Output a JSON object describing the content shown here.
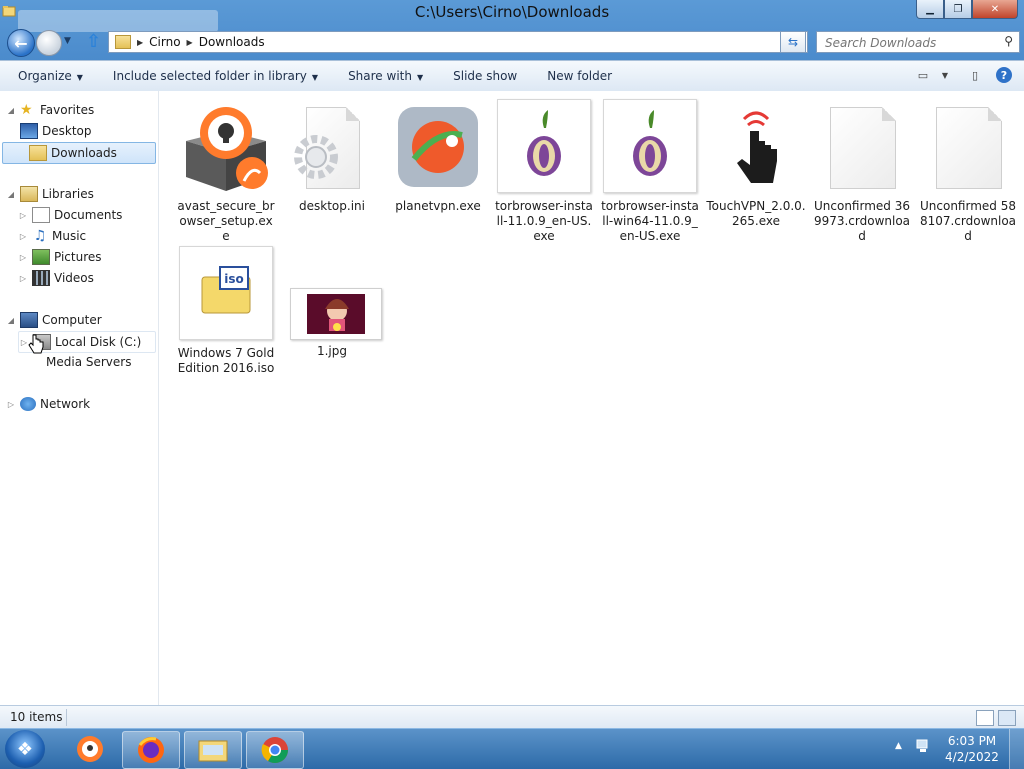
{
  "window": {
    "title": "C:\\Users\\Cirno\\Downloads"
  },
  "address": {
    "crumbs": [
      "Cirno",
      "Downloads"
    ]
  },
  "search": {
    "placeholder": "Search Downloads"
  },
  "toolbar": {
    "organize": "Organize",
    "include": "Include selected folder in library",
    "share": "Share with",
    "slideshow": "Slide show",
    "newfolder": "New folder"
  },
  "sidebar": {
    "favorites": "Favorites",
    "desktop": "Desktop",
    "downloads": "Downloads",
    "libraries": "Libraries",
    "documents": "Documents",
    "music": "Music",
    "pictures": "Pictures",
    "videos": "Videos",
    "computer": "Computer",
    "localdisk": "Local Disk (C:)",
    "mediaservers": "Media Servers",
    "network": "Network"
  },
  "files": [
    {
      "name": "avast_secure_browser_setup.exe",
      "icon": "avast-installer-icon"
    },
    {
      "name": "desktop.ini",
      "icon": "settings-file-icon"
    },
    {
      "name": "planetvpn.exe",
      "icon": "planetvpn-icon"
    },
    {
      "name": "torbrowser-install-11.0.9_en-US.exe",
      "icon": "tor-onion-icon"
    },
    {
      "name": "torbrowser-install-win64-11.0.9_en-US.exe",
      "icon": "tor-onion-icon"
    },
    {
      "name": "TouchVPN_2.0.0.265.exe",
      "icon": "touchvpn-hand-icon"
    },
    {
      "name": "Unconfirmed 369973.crdownload",
      "icon": "blank-file-icon"
    },
    {
      "name": "Unconfirmed 588107.crdownload",
      "icon": "blank-file-icon"
    },
    {
      "name": "Windows 7 Gold Edition 2016.iso",
      "icon": "iso-disc-icon"
    },
    {
      "name": "1.jpg",
      "icon": "image-thumbnail"
    }
  ],
  "status": {
    "count": "10 items"
  },
  "clock": {
    "time": "6:03 PM",
    "date": "4/2/2022"
  }
}
